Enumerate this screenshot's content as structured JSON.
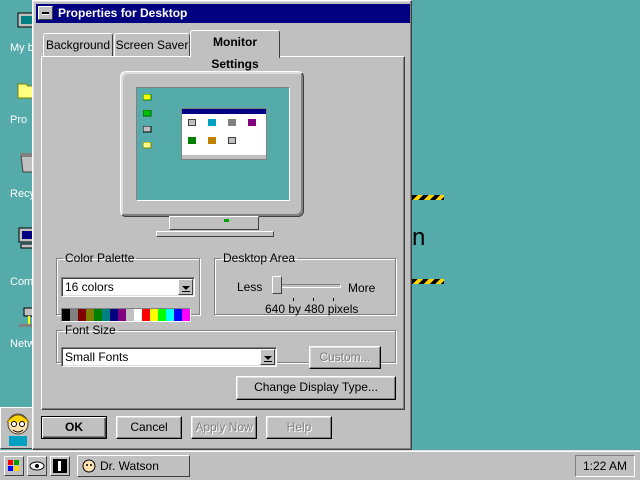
{
  "desktop": {
    "icons": [
      {
        "label": "My b",
        "icon": "my-computer-icon"
      },
      {
        "label": "Pro",
        "icon": "folder-icon"
      },
      {
        "label": "Recy",
        "icon": "recycle-bin-icon"
      },
      {
        "label": "Comp",
        "icon": "computer-icon"
      },
      {
        "label": "Netw",
        "icon": "network-icon"
      }
    ],
    "background_text": "n",
    "background_color": "#55aaaa"
  },
  "dialog": {
    "title": "Properties for Desktop",
    "tabs": [
      {
        "label": "Background"
      },
      {
        "label": "Screen Saver"
      },
      {
        "label": "Monitor Settings"
      }
    ],
    "active_tab": "Monitor Settings",
    "color_palette": {
      "label": "Color Palette",
      "selected": "16 colors",
      "swatches": [
        "#000000",
        "#808080",
        "#800000",
        "#808000",
        "#008000",
        "#008080",
        "#000080",
        "#800080",
        "#c0c0c0",
        "#ffffff",
        "#ff0000",
        "#ffff00",
        "#00ff00",
        "#00ffff",
        "#0000ff",
        "#ff00ff"
      ]
    },
    "desktop_area": {
      "label": "Desktop Area",
      "less_label": "Less",
      "more_label": "More",
      "value_text": "640 by 480 pixels",
      "slider_position": 0
    },
    "font_size": {
      "label": "Font Size",
      "selected": "Small Fonts",
      "custom_button": "Custom..."
    },
    "change_display_button": "Change Display Type...",
    "buttons": {
      "ok": "OK",
      "cancel": "Cancel",
      "apply": "Apply Now",
      "help": "Help"
    }
  },
  "taskbar": {
    "task_label": "Dr. Watson",
    "clock": "1:22 AM"
  }
}
